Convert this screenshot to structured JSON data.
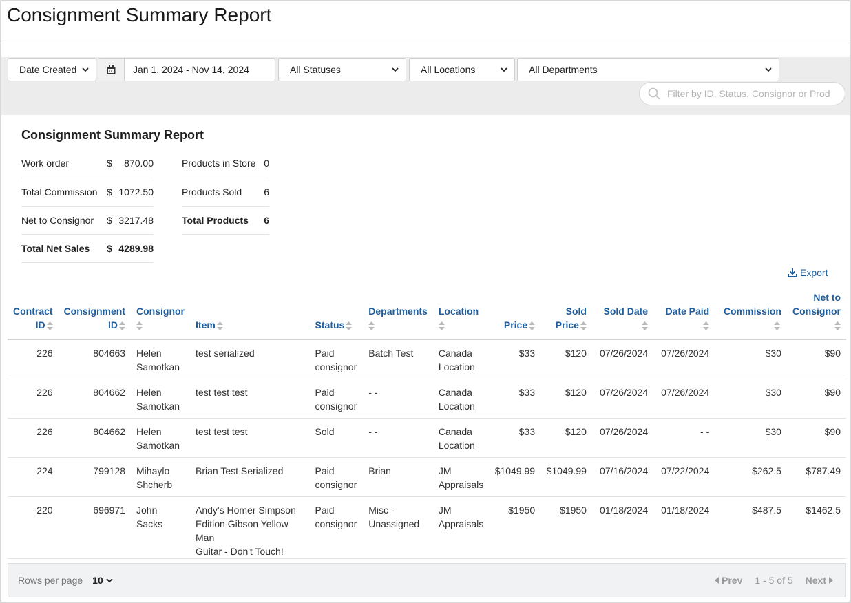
{
  "page": {
    "title": "Consignment Summary Report"
  },
  "filters": {
    "date_field": "Date Created",
    "date_range": "Jan 1, 2024 - Nov 14, 2024",
    "status": "All Statuses",
    "location": "All Locations",
    "department": "All Departments",
    "search_placeholder": "Filter by ID, Status, Consignor or Product"
  },
  "summary": {
    "title": "Consignment Summary Report",
    "left": [
      {
        "label": "Work order",
        "currency": "$",
        "value": "870.00",
        "bold": false
      },
      {
        "label": "Total Commission",
        "currency": "$",
        "value": "1072.50",
        "bold": false
      },
      {
        "label": "Net to Consignor",
        "currency": "$",
        "value": "3217.48",
        "bold": false
      },
      {
        "label": "Total Net Sales",
        "currency": "$",
        "value": "4289.98",
        "bold": true
      }
    ],
    "right": [
      {
        "label": "Products in Store",
        "value": "0",
        "bold": false
      },
      {
        "label": "Products Sold",
        "value": "6",
        "bold": false
      },
      {
        "label": "Total Products",
        "value": "6",
        "bold": true
      }
    ]
  },
  "export_label": "Export",
  "table": {
    "headers": {
      "contract_id": [
        "Contract",
        "ID"
      ],
      "consignment_id": [
        "Consignment",
        "ID"
      ],
      "consignor": [
        "Consignor"
      ],
      "item": [
        "Item"
      ],
      "status": [
        "Status"
      ],
      "departments": [
        "Departments"
      ],
      "location": [
        "Location"
      ],
      "price": [
        "Price"
      ],
      "sold_price": [
        "Sold",
        "Price"
      ],
      "sold_date": [
        "Sold Date"
      ],
      "date_paid": [
        "Date Paid"
      ],
      "commission": [
        "Commission"
      ],
      "net_to_consignor": [
        "Net to",
        "Consignor"
      ]
    },
    "rows": [
      {
        "contract_id": "226",
        "consignment_id": "804663",
        "consignor": [
          "Helen",
          "Samotkan"
        ],
        "item": [
          "test serialized"
        ],
        "status": [
          "Paid",
          "consignor"
        ],
        "departments": [
          "Batch Test"
        ],
        "location": [
          "Canada",
          "Location"
        ],
        "price": "$33",
        "sold_price": "$120",
        "sold_date": "07/26/2024",
        "date_paid": "07/26/2024",
        "commission": "$30",
        "net": "$90"
      },
      {
        "contract_id": "226",
        "consignment_id": "804662",
        "consignor": [
          "Helen",
          "Samotkan"
        ],
        "item": [
          "test test test"
        ],
        "status": [
          "Paid",
          "consignor"
        ],
        "departments": [
          "- -"
        ],
        "location": [
          "Canada",
          "Location"
        ],
        "price": "$33",
        "sold_price": "$120",
        "sold_date": "07/26/2024",
        "date_paid": "07/26/2024",
        "commission": "$30",
        "net": "$90"
      },
      {
        "contract_id": "226",
        "consignment_id": "804662",
        "consignor": [
          "Helen",
          "Samotkan"
        ],
        "item": [
          "test test test"
        ],
        "status": [
          "Sold"
        ],
        "departments": [
          "- -"
        ],
        "location": [
          "Canada",
          "Location"
        ],
        "price": "$33",
        "sold_price": "$120",
        "sold_date": "07/26/2024",
        "date_paid": "- -",
        "commission": "$30",
        "net": "$90"
      },
      {
        "contract_id": "224",
        "consignment_id": "799128",
        "consignor": [
          "Mihaylo",
          "Shcherb"
        ],
        "item": [
          "Brian Test Serialized"
        ],
        "status": [
          "Paid",
          "consignor"
        ],
        "departments": [
          "Brian"
        ],
        "location": [
          "JM",
          "Appraisals"
        ],
        "price": "$1049.99",
        "sold_price": "$1049.99",
        "sold_date": "07/16/2024",
        "date_paid": "07/22/2024",
        "commission": "$262.5",
        "net": "$787.49"
      },
      {
        "contract_id": "220",
        "consignment_id": "696971",
        "consignor": [
          "John",
          "Sacks"
        ],
        "item": [
          "Andy's Homer Simpson",
          "Edition Gibson Yellow Man",
          "Guitar - Don't Touch!"
        ],
        "status": [
          "Paid",
          "consignor"
        ],
        "departments": [
          "Misc -",
          "Unassigned"
        ],
        "location": [
          "JM",
          "Appraisals"
        ],
        "price": "$1950",
        "sold_price": "$1950",
        "sold_date": "01/18/2024",
        "date_paid": "01/18/2024",
        "commission": "$487.5",
        "net": "$1462.5"
      }
    ]
  },
  "footer": {
    "rows_per_page_label": "Rows per page",
    "rows_per_page_value": "10",
    "prev_label": "Prev",
    "range_text": "1 - 5 of 5",
    "next_label": "Next"
  },
  "icons": {
    "chevron": "chevron-down-icon",
    "calendar": "calendar-icon",
    "search": "search-icon",
    "export": "download-icon",
    "sort": "sort-icon",
    "prev": "caret-left-icon",
    "next": "caret-right-icon"
  },
  "colors": {
    "accent": "#1f5e9e",
    "filter_bg": "#ececec",
    "footer_bg": "#f0f2f4"
  }
}
